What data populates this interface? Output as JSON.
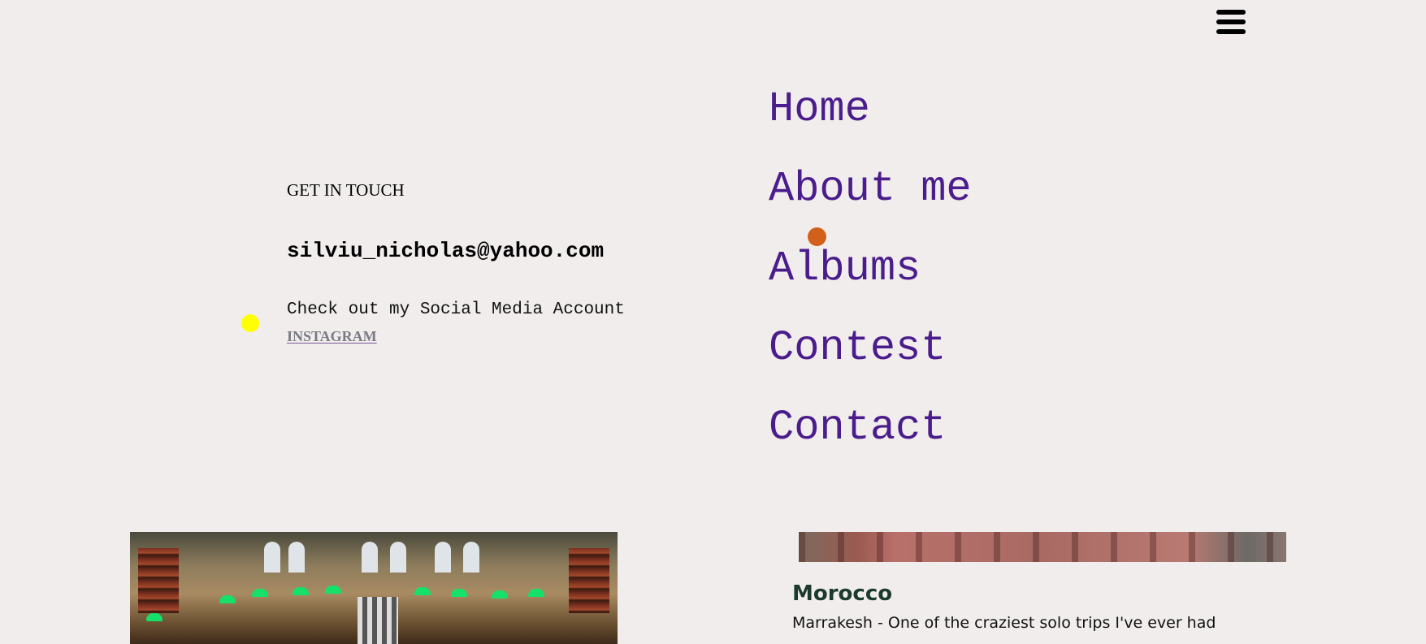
{
  "header": {
    "menu_icon": "hamburger-menu-icon"
  },
  "contact": {
    "heading": "GET IN TOUCH",
    "email": "silviu_nicholas@yahoo.com",
    "social_text": "Check out my Social Media Account",
    "instagram_label": "INSTAGRAM"
  },
  "nav": {
    "items": [
      {
        "label": "Home"
      },
      {
        "label": "About me"
      },
      {
        "label": "Albums"
      },
      {
        "label": "Contest"
      },
      {
        "label": "Contact"
      }
    ]
  },
  "cards": {
    "right": {
      "title": "Morocco",
      "description": "Marrakesh - One of the craziest solo trips I've ever had"
    }
  },
  "colors": {
    "background": "#f1eded",
    "nav_link": "#4b1d8c",
    "yellow_dot": "#ffff00",
    "orange_dot": "#d2601a",
    "card_title": "#1c3a2e"
  }
}
